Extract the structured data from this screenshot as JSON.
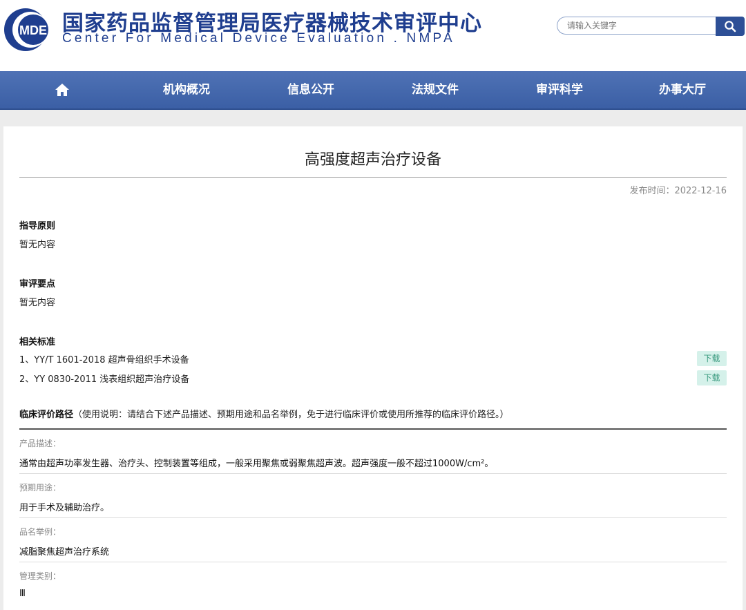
{
  "header": {
    "logo_text": "MDE",
    "title_cn": "国家药品监督管理局医疗器械技术审评中心",
    "title_en": "Center For Medical Device Evaluation . NMPA",
    "search_placeholder": "请输入关键字",
    "colors": {
      "brand_blue": "#1f3e8f",
      "nav_blue": "#3b5fa5"
    }
  },
  "nav": {
    "items": [
      {
        "label": "机构概况"
      },
      {
        "label": "信息公开"
      },
      {
        "label": "法规文件"
      },
      {
        "label": "审评科学"
      },
      {
        "label": "办事大厅"
      }
    ]
  },
  "page": {
    "title": "高强度超声治疗设备",
    "publish_time": "发布时间：2022-12-16"
  },
  "guidance": {
    "heading": "指导原则",
    "text": "暂无内容"
  },
  "review_points": {
    "heading": "审评要点",
    "text": "暂无内容"
  },
  "standards": {
    "heading": "相关标准",
    "download_label": "下载",
    "items": [
      {
        "text": "1、YY/T 1601-2018 超声骨组织手术设备"
      },
      {
        "text": "2、YY 0830-2011 浅表组织超声治疗设备"
      }
    ]
  },
  "clinical": {
    "heading": "临床评价路径",
    "note": "（使用说明：请结合下述产品描述、预期用途和品名举例，免于进行临床评价或使用所推荐的临床评价路径。）",
    "fields": [
      {
        "label": "产品描述：",
        "value": "通常由超声功率发生器、治疗头、控制装置等组成，一般采用聚焦或弱聚焦超声波。超声强度一般不超过1000W/cm²。"
      },
      {
        "label": "预期用途：",
        "value": "用于手术及辅助治疗。"
      },
      {
        "label": "品名举例：",
        "value": "减脂聚焦超声治疗系统"
      },
      {
        "label": "管理类别：",
        "value": "Ⅲ"
      }
    ]
  }
}
